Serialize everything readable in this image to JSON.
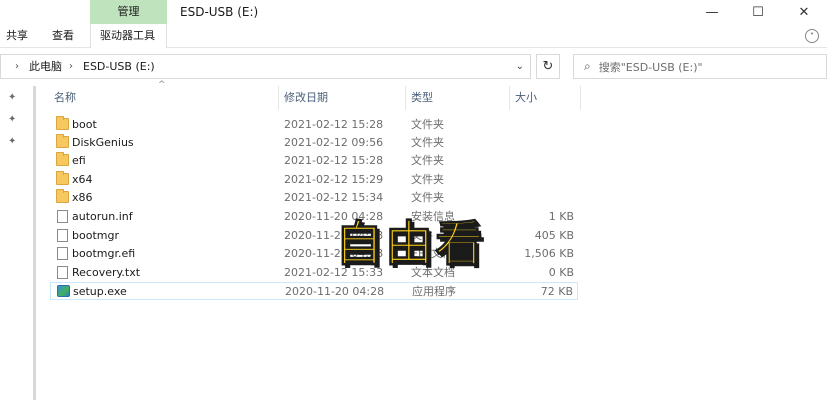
{
  "titlebar": {
    "context_tab": "管理",
    "title": "ESD-USB (E:)",
    "minimize_glyph": "—",
    "maximize_glyph": "☐",
    "close_glyph": "✕"
  },
  "ribbon": {
    "tabs": [
      "共享",
      "查看",
      "驱动器工具"
    ],
    "expand_glyph": "˅"
  },
  "address": {
    "crumbs": [
      "此电脑",
      "ESD-USB (E:)"
    ],
    "separator": "›",
    "dropdown_glyph": "⌄",
    "refresh_glyph": "↻"
  },
  "search": {
    "placeholder": "搜索\"ESD-USB (E:)\""
  },
  "columns": {
    "name": "名称",
    "date": "修改日期",
    "type": "类型",
    "size": "大小"
  },
  "files": [
    {
      "name": "boot",
      "date": "2021-02-12 15:28",
      "type": "文件夹",
      "size": "",
      "icon": "folder-icon"
    },
    {
      "name": "DiskGenius",
      "date": "2021-02-12 09:56",
      "type": "文件夹",
      "size": "",
      "icon": "folder-icon"
    },
    {
      "name": "efi",
      "date": "2021-02-12 15:28",
      "type": "文件夹",
      "size": "",
      "icon": "folder-icon"
    },
    {
      "name": "x64",
      "date": "2021-02-12 15:29",
      "type": "文件夹",
      "size": "",
      "icon": "folder-icon"
    },
    {
      "name": "x86",
      "date": "2021-02-12 15:34",
      "type": "文件夹",
      "size": "",
      "icon": "folder-icon"
    },
    {
      "name": "autorun.inf",
      "date": "2020-11-20 04:28",
      "type": "安装信息",
      "size": "1 KB",
      "icon": "document-icon"
    },
    {
      "name": "bootmgr",
      "date": "2020-11-20 04:28",
      "type": "文件",
      "size": "405 KB",
      "icon": "document-icon"
    },
    {
      "name": "bootmgr.efi",
      "date": "2020-11-20 04:28",
      "type": "EFI 文件",
      "size": "1,506 KB",
      "icon": "document-icon"
    },
    {
      "name": "Recovery.txt",
      "date": "2021-02-12 15:33",
      "type": "文本文档",
      "size": "0 KB",
      "icon": "document-icon"
    },
    {
      "name": "setup.exe",
      "date": "2020-11-20 04:28",
      "type": "应用程序",
      "size": "72 KB",
      "icon": "exe-icon"
    }
  ],
  "watermark": {
    "text": "自由看"
  },
  "colors": {
    "context_tab_bg": "#bfe3bd",
    "selection_border": "#cce8ff",
    "folder_yellow": "#f6c85f",
    "watermark_yellow": "#ffd31a"
  }
}
